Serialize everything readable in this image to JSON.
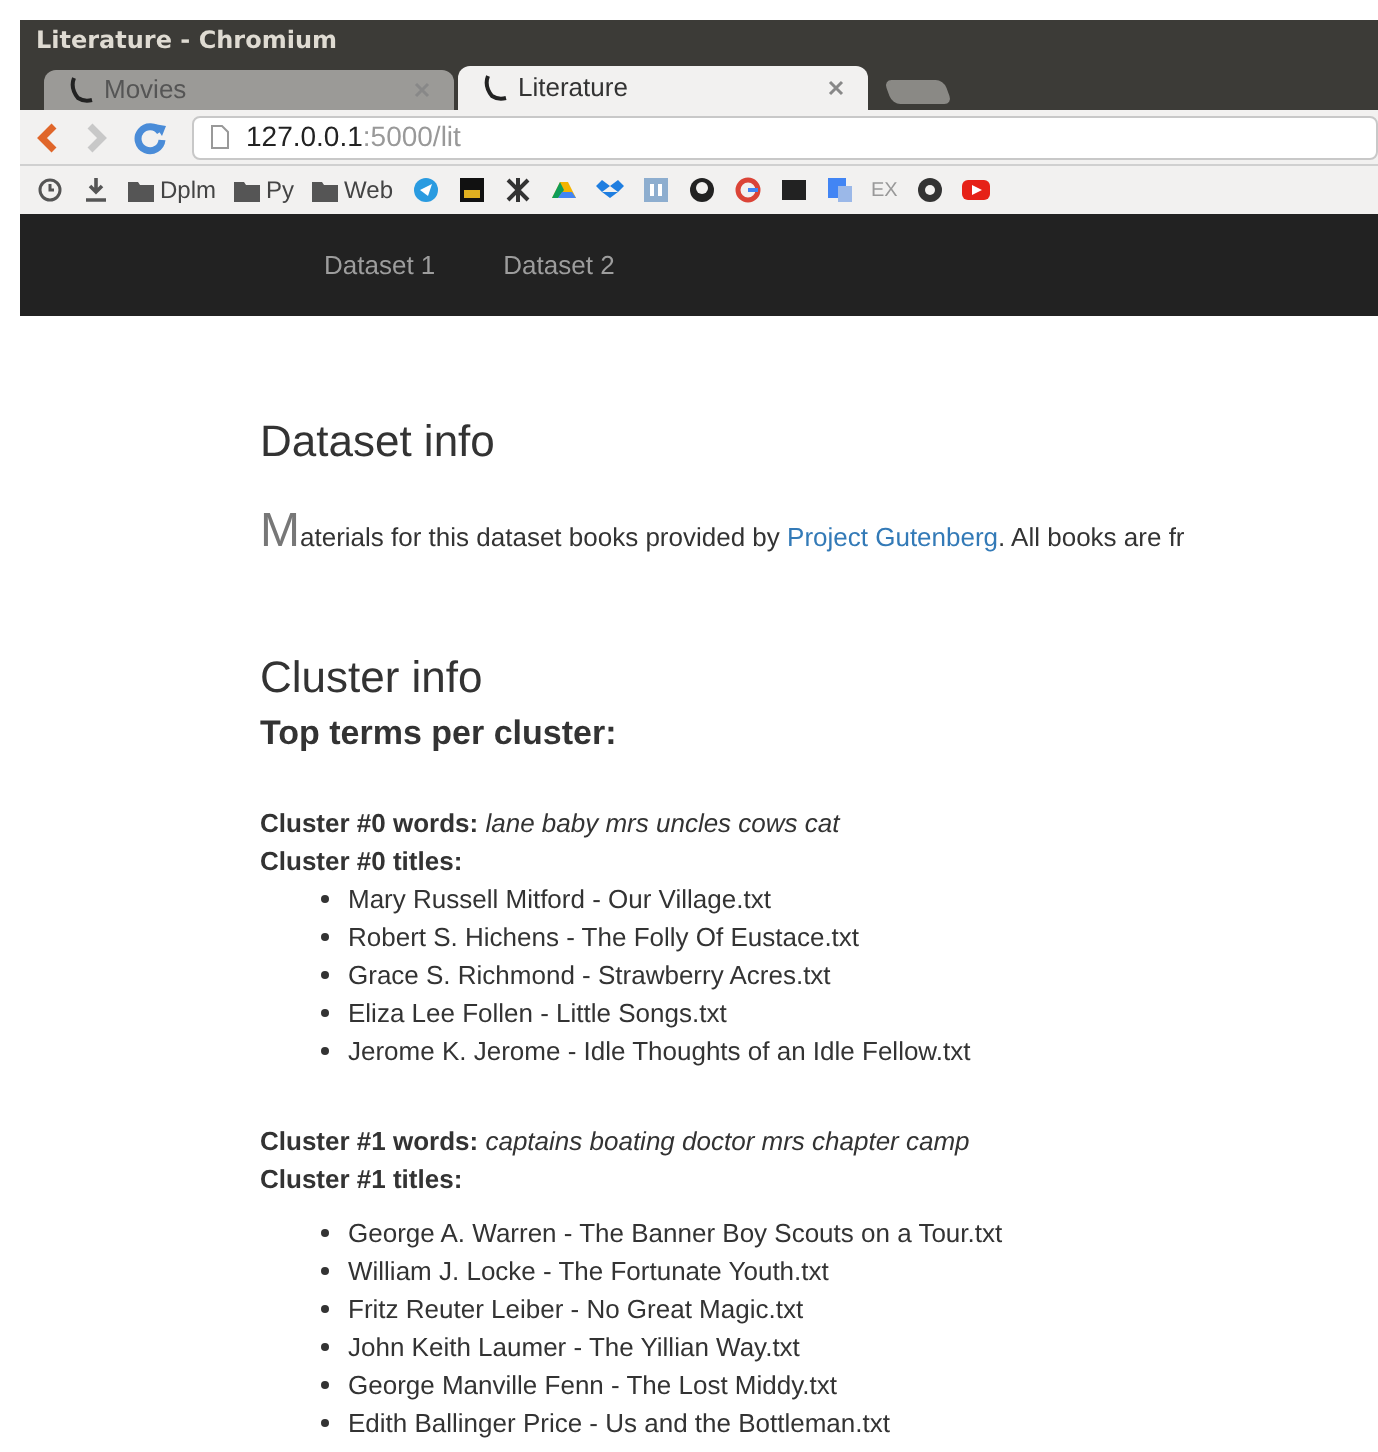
{
  "window": {
    "title": "Literature - Chromium"
  },
  "tabs": [
    {
      "label": "Movies",
      "selected": false
    },
    {
      "label": "Literature",
      "selected": true
    }
  ],
  "address_bar": {
    "host": "127.0.0.1",
    "path": ":5000/lit"
  },
  "bookmarks": [
    {
      "kind": "history"
    },
    {
      "kind": "download"
    },
    {
      "kind": "folder",
      "label": "Dplm"
    },
    {
      "kind": "folder",
      "label": "Py"
    },
    {
      "kind": "folder",
      "label": "Web"
    },
    {
      "kind": "icon"
    },
    {
      "kind": "icon"
    },
    {
      "kind": "icon"
    },
    {
      "kind": "icon"
    },
    {
      "kind": "icon"
    },
    {
      "kind": "icon"
    },
    {
      "kind": "icon"
    },
    {
      "kind": "icon"
    },
    {
      "kind": "icon"
    },
    {
      "kind": "icon"
    },
    {
      "kind": "text",
      "label": "EX"
    },
    {
      "kind": "icon"
    },
    {
      "kind": "icon"
    }
  ],
  "navbar": {
    "items": [
      {
        "label": "Dataset 1"
      },
      {
        "label": "Dataset 2"
      }
    ]
  },
  "dataset_info": {
    "heading": "Dataset info",
    "drop_cap": "M",
    "text": "aterials for this dataset books provided by ",
    "link": "Project Gutenberg",
    "text_after": ". All books are fr"
  },
  "cluster_info": {
    "heading": "Cluster info",
    "subheading": "Top terms per cluster:"
  },
  "clusters": [
    {
      "words_label": "Cluster #0 words:",
      "words": "lane baby mrs uncles cows cat",
      "titles_label": "Cluster #0 titles:",
      "titles": [
        "Mary Russell Mitford - Our Village.txt",
        "Robert S. Hichens - The Folly Of Eustace.txt",
        "Grace S. Richmond - Strawberry Acres.txt",
        "Eliza Lee Follen - Little Songs.txt",
        "Jerome K. Jerome - Idle Thoughts of an Idle Fellow.txt"
      ]
    },
    {
      "words_label": "Cluster #1 words:",
      "words": "captains boating doctor mrs chapter camp",
      "titles_label": "Cluster #1 titles:",
      "titles": [
        "George A. Warren - The Banner Boy Scouts on a Tour.txt",
        "William J. Locke - The Fortunate Youth.txt",
        "Fritz Reuter Leiber - No Great Magic.txt",
        "John Keith Laumer - The Yillian Way.txt",
        "George Manville Fenn - The Lost Middy.txt",
        "Edith Ballinger Price - Us and the Bottleman.txt"
      ]
    }
  ]
}
